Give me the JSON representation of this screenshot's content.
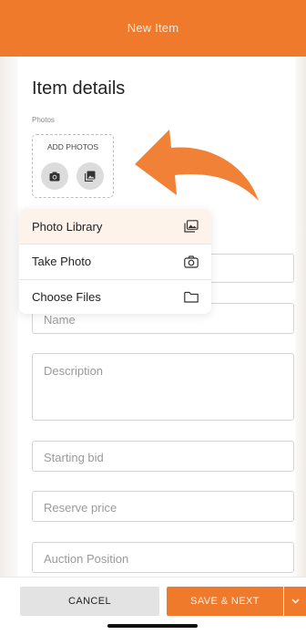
{
  "header": {
    "title": "New Item"
  },
  "section": {
    "title": "Item details",
    "photos_label": "Photos"
  },
  "photo_box": {
    "label": "ADD PHOTOS"
  },
  "menu": {
    "items": [
      {
        "label": "Photo Library",
        "icon": "photo-library-icon"
      },
      {
        "label": "Take Photo",
        "icon": "camera-icon"
      },
      {
        "label": "Choose Files",
        "icon": "folder-icon"
      }
    ]
  },
  "fields": {
    "name": {
      "placeholder": "Name"
    },
    "description": {
      "placeholder": "Description"
    },
    "starting_bid": {
      "placeholder": "Starting bid"
    },
    "reserve_price": {
      "placeholder": "Reserve price"
    },
    "auction_position": {
      "placeholder": "Auction Position"
    }
  },
  "footer": {
    "cancel_label": "CANCEL",
    "save_label": "SAVE & NEXT"
  },
  "colors": {
    "accent": "#f07a2c",
    "menu_highlight": "#fdf3ea",
    "field_border": "#d3d3d3"
  }
}
